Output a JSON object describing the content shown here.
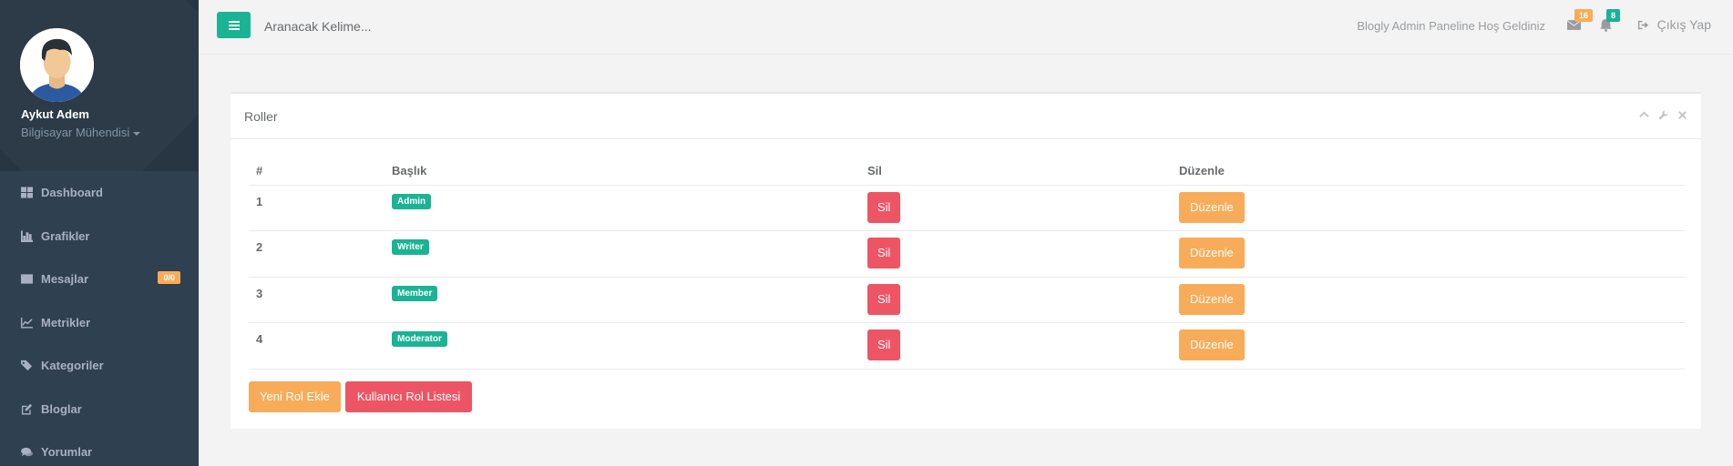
{
  "colors": {
    "sidebar": "#2f4050",
    "accent": "#1ab394",
    "warning": "#f8ac59",
    "danger": "#ed5565"
  },
  "profile": {
    "name": "Aykut Adem",
    "role": "Bilgisayar Mühendisi",
    "avatar_icon": "user-avatar-icon"
  },
  "sidebar": {
    "items": [
      {
        "label": "Dashboard",
        "icon": "grid-icon"
      },
      {
        "label": "Grafikler",
        "icon": "bar-chart-icon"
      },
      {
        "label": "Mesajlar",
        "icon": "envelope-icon",
        "badge": "0/0"
      },
      {
        "label": "Metrikler",
        "icon": "line-chart-icon"
      },
      {
        "label": "Kategoriler",
        "icon": "tags-icon"
      },
      {
        "label": "Bloglar",
        "icon": "edit-icon"
      },
      {
        "label": "Yorumlar",
        "icon": "comments-icon"
      }
    ]
  },
  "topbar": {
    "menu_icon": "bars-icon",
    "search_placeholder": "Aranacak Kelime...",
    "welcome": "Blogly Admin Paneline Hoş Geldiniz",
    "messages_count": "16",
    "notifications_count": "8",
    "logout": "Çıkış Yap"
  },
  "panel": {
    "title": "Roller",
    "table": {
      "headers": [
        "#",
        "Başlık",
        "Sil",
        "Düzenle"
      ],
      "rows": [
        {
          "id": "1",
          "title": "Admin",
          "delete": "Sil",
          "edit": "Düzenle"
        },
        {
          "id": "2",
          "title": "Writer",
          "delete": "Sil",
          "edit": "Düzenle"
        },
        {
          "id": "3",
          "title": "Member",
          "delete": "Sil",
          "edit": "Düzenle"
        },
        {
          "id": "4",
          "title": "Moderator",
          "delete": "Sil",
          "edit": "Düzenle"
        }
      ]
    },
    "add_button": "Yeni Rol Ekle",
    "list_button": "Kullanıcı Rol Listesi"
  }
}
